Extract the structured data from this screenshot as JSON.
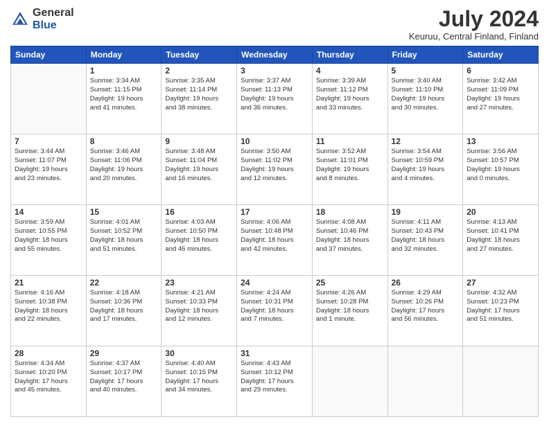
{
  "logo": {
    "general": "General",
    "blue": "Blue"
  },
  "header": {
    "month_year": "July 2024",
    "location": "Keuruu, Central Finland, Finland"
  },
  "weekdays": [
    "Sunday",
    "Monday",
    "Tuesday",
    "Wednesday",
    "Thursday",
    "Friday",
    "Saturday"
  ],
  "weeks": [
    [
      {
        "day": "",
        "info": ""
      },
      {
        "day": "1",
        "info": "Sunrise: 3:34 AM\nSunset: 11:15 PM\nDaylight: 19 hours\nand 41 minutes."
      },
      {
        "day": "2",
        "info": "Sunrise: 3:35 AM\nSunset: 11:14 PM\nDaylight: 19 hours\nand 38 minutes."
      },
      {
        "day": "3",
        "info": "Sunrise: 3:37 AM\nSunset: 11:13 PM\nDaylight: 19 hours\nand 36 minutes."
      },
      {
        "day": "4",
        "info": "Sunrise: 3:39 AM\nSunset: 11:12 PM\nDaylight: 19 hours\nand 33 minutes."
      },
      {
        "day": "5",
        "info": "Sunrise: 3:40 AM\nSunset: 11:10 PM\nDaylight: 19 hours\nand 30 minutes."
      },
      {
        "day": "6",
        "info": "Sunrise: 3:42 AM\nSunset: 11:09 PM\nDaylight: 19 hours\nand 27 minutes."
      }
    ],
    [
      {
        "day": "7",
        "info": "Sunrise: 3:44 AM\nSunset: 11:07 PM\nDaylight: 19 hours\nand 23 minutes."
      },
      {
        "day": "8",
        "info": "Sunrise: 3:46 AM\nSunset: 11:06 PM\nDaylight: 19 hours\nand 20 minutes."
      },
      {
        "day": "9",
        "info": "Sunrise: 3:48 AM\nSunset: 11:04 PM\nDaylight: 19 hours\nand 16 minutes."
      },
      {
        "day": "10",
        "info": "Sunrise: 3:50 AM\nSunset: 11:02 PM\nDaylight: 19 hours\nand 12 minutes."
      },
      {
        "day": "11",
        "info": "Sunrise: 3:52 AM\nSunset: 11:01 PM\nDaylight: 19 hours\nand 8 minutes."
      },
      {
        "day": "12",
        "info": "Sunrise: 3:54 AM\nSunset: 10:59 PM\nDaylight: 19 hours\nand 4 minutes."
      },
      {
        "day": "13",
        "info": "Sunrise: 3:56 AM\nSunset: 10:57 PM\nDaylight: 19 hours\nand 0 minutes."
      }
    ],
    [
      {
        "day": "14",
        "info": "Sunrise: 3:59 AM\nSunset: 10:55 PM\nDaylight: 18 hours\nand 55 minutes."
      },
      {
        "day": "15",
        "info": "Sunrise: 4:01 AM\nSunset: 10:52 PM\nDaylight: 18 hours\nand 51 minutes."
      },
      {
        "day": "16",
        "info": "Sunrise: 4:03 AM\nSunset: 10:50 PM\nDaylight: 18 hours\nand 46 minutes."
      },
      {
        "day": "17",
        "info": "Sunrise: 4:06 AM\nSunset: 10:48 PM\nDaylight: 18 hours\nand 42 minutes."
      },
      {
        "day": "18",
        "info": "Sunrise: 4:08 AM\nSunset: 10:46 PM\nDaylight: 18 hours\nand 37 minutes."
      },
      {
        "day": "19",
        "info": "Sunrise: 4:11 AM\nSunset: 10:43 PM\nDaylight: 18 hours\nand 32 minutes."
      },
      {
        "day": "20",
        "info": "Sunrise: 4:13 AM\nSunset: 10:41 PM\nDaylight: 18 hours\nand 27 minutes."
      }
    ],
    [
      {
        "day": "21",
        "info": "Sunrise: 4:16 AM\nSunset: 10:38 PM\nDaylight: 18 hours\nand 22 minutes."
      },
      {
        "day": "22",
        "info": "Sunrise: 4:18 AM\nSunset: 10:36 PM\nDaylight: 18 hours\nand 17 minutes."
      },
      {
        "day": "23",
        "info": "Sunrise: 4:21 AM\nSunset: 10:33 PM\nDaylight: 18 hours\nand 12 minutes."
      },
      {
        "day": "24",
        "info": "Sunrise: 4:24 AM\nSunset: 10:31 PM\nDaylight: 18 hours\nand 7 minutes."
      },
      {
        "day": "25",
        "info": "Sunrise: 4:26 AM\nSunset: 10:28 PM\nDaylight: 18 hours\nand 1 minute."
      },
      {
        "day": "26",
        "info": "Sunrise: 4:29 AM\nSunset: 10:26 PM\nDaylight: 17 hours\nand 56 minutes."
      },
      {
        "day": "27",
        "info": "Sunrise: 4:32 AM\nSunset: 10:23 PM\nDaylight: 17 hours\nand 51 minutes."
      }
    ],
    [
      {
        "day": "28",
        "info": "Sunrise: 4:34 AM\nSunset: 10:20 PM\nDaylight: 17 hours\nand 45 minutes."
      },
      {
        "day": "29",
        "info": "Sunrise: 4:37 AM\nSunset: 10:17 PM\nDaylight: 17 hours\nand 40 minutes."
      },
      {
        "day": "30",
        "info": "Sunrise: 4:40 AM\nSunset: 10:15 PM\nDaylight: 17 hours\nand 34 minutes."
      },
      {
        "day": "31",
        "info": "Sunrise: 4:43 AM\nSunset: 10:12 PM\nDaylight: 17 hours\nand 29 minutes."
      },
      {
        "day": "",
        "info": ""
      },
      {
        "day": "",
        "info": ""
      },
      {
        "day": "",
        "info": ""
      }
    ]
  ]
}
